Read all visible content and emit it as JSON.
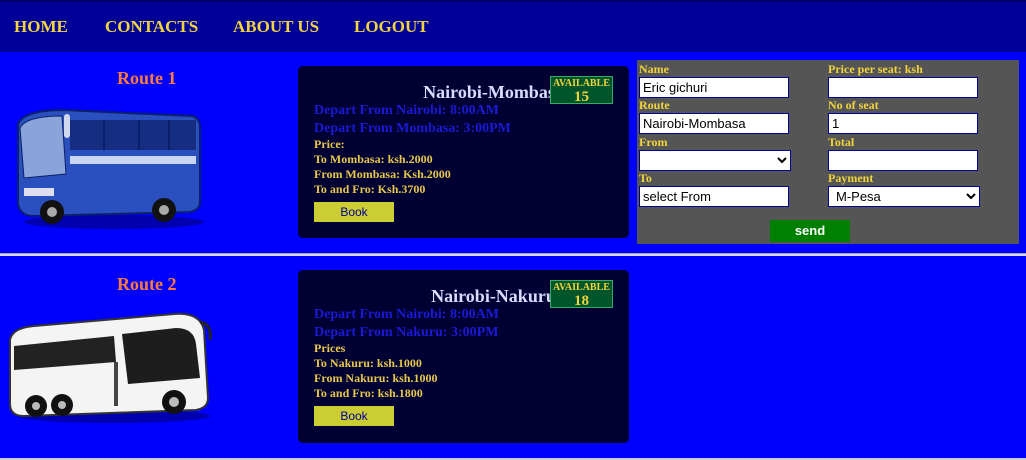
{
  "nav": {
    "home": "HOME",
    "contacts": "CONTACTS",
    "about": "ABOUT US",
    "logout": "LOGOUT"
  },
  "routes": [
    {
      "title": "Route 1",
      "name": "Nairobi-Mombasa",
      "available_label": "AVAILABLE",
      "available_count": "15",
      "depart1": "Depart From Nairobi: 8:00AM",
      "depart2": "Depart From Mombasa: 3:00PM",
      "price_heading": "Price:",
      "price1": "To Mombasa: ksh.2000",
      "price2": "From Mombasa: Ksh.2000",
      "price3": "To and Fro: Ksh.3700",
      "book": "Book",
      "bus_color": "#2a4fbf"
    },
    {
      "title": "Route 2",
      "name": "Nairobi-Nakuru",
      "available_label": "AVAILABLE",
      "available_count": "18",
      "depart1": "Depart From Nairobi: 8:00AM",
      "depart2": "Depart From Nakuru: 3:00PM",
      "price_heading": "Prices",
      "price1": "To Nakuru: ksh.1000",
      "price2": "From Nakuru: ksh.1000",
      "price3": "To and Fro: ksh.1800",
      "book": "Book",
      "bus_color": "#f4f4f4"
    }
  ],
  "form": {
    "name_label": "Name",
    "name_value": "Eric gichuri",
    "price_label": "Price per seat: ksh",
    "price_value": "",
    "route_label": "Route",
    "route_value": "Nairobi-Mombasa",
    "seats_label": "No of seat",
    "seats_value": "1",
    "from_label": "From",
    "from_value": "",
    "total_label": "Total",
    "total_value": "",
    "to_label": "To",
    "to_value": "select From",
    "payment_label": "Payment",
    "payment_value": "M-Pesa",
    "send": "send"
  },
  "colors": {
    "nav_bg": "#000099",
    "section_bg": "#0000ff",
    "card_bg": "#000033",
    "accent_yellow": "#f2d43c",
    "route_title": "#ff7a3c",
    "send_green": "#008000"
  }
}
